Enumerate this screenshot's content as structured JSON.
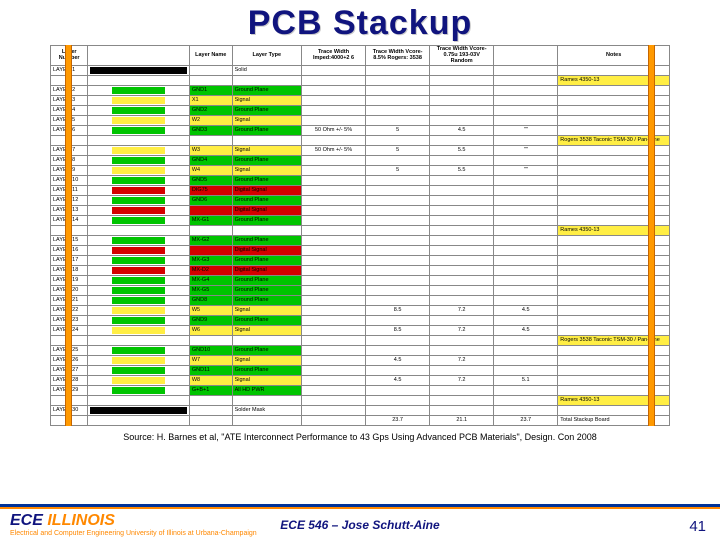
{
  "title": "PCB Stackup",
  "headers": {
    "layernum": "Layer Number",
    "layername": "Layer Name",
    "layertype": "Layer Type",
    "tw1": "Trace Width Imped:4000+2 6",
    "tw2": "Trace Width Vcore-8.5% Rogers: 3538",
    "tw3": "Trace Width Vcore-0.75u 193-03V Random",
    "notes": "Notes"
  },
  "rows": [
    {
      "ln": "LAYER 1",
      "bar": "full",
      "nm": "",
      "typ": "Solid",
      "cls": "",
      "n": ""
    },
    {
      "ln": "",
      "bar": "",
      "nm": "",
      "typ": "",
      "cls": "yel",
      "n": "Rames 4350-13"
    },
    {
      "ln": "LAYER 2",
      "bar": "gnd",
      "nm": "GND1",
      "typ": "Ground Plane",
      "cls": "",
      "n": ""
    },
    {
      "ln": "LAYER 3",
      "bar": "sig",
      "nm": "X1",
      "typ": "Signal",
      "cls": "",
      "n": ""
    },
    {
      "ln": "LAYER 4",
      "bar": "gnd",
      "nm": "GND2",
      "typ": "Ground Plane",
      "cls": "",
      "n": ""
    },
    {
      "ln": "LAYER 5",
      "bar": "sig",
      "nm": "W2",
      "typ": "Signal",
      "cls": "",
      "n": ""
    },
    {
      "ln": "LAYER 6",
      "bar": "gnd",
      "nm": "GND3",
      "typ": "Ground Plane",
      "cls": "",
      "t1": "50 Ohm +/- 5%",
      "t2": "5",
      "t3": "4.5",
      "tn": "\"\"",
      "n": ""
    },
    {
      "ln": "",
      "bar": "",
      "nm": "",
      "typ": "",
      "cls": "yel",
      "n": "Rogers 3538 Taconic TSM-30 / Pan-Fine"
    },
    {
      "ln": "LAYER 7",
      "bar": "sig",
      "nm": "W3",
      "typ": "Signal",
      "cls": "",
      "t1": "50 Ohm +/- 5%",
      "t2": "5",
      "t3": "5.5",
      "tn": "\"\"",
      "n": ""
    },
    {
      "ln": "LAYER 8",
      "bar": "gnd",
      "nm": "GND4",
      "typ": "Ground Plane",
      "cls": "",
      "n": ""
    },
    {
      "ln": "LAYER 9",
      "bar": "sig",
      "nm": "W4",
      "typ": "Signal",
      "cls": "",
      "t1": "",
      "t2": "5",
      "t3": "5.5",
      "tn": "\"\"",
      "n": ""
    },
    {
      "ln": "LAYER 10",
      "bar": "gnd",
      "nm": "GND5",
      "typ": "Ground Plane",
      "cls": "",
      "n": ""
    },
    {
      "ln": "LAYER 11",
      "bar": "dig",
      "nm": "DIG75",
      "typ": "Digital Signal",
      "cls": "",
      "n": ""
    },
    {
      "ln": "LAYER 12",
      "bar": "gnd",
      "nm": "GND6",
      "typ": "Ground Plane",
      "cls": "",
      "n": ""
    },
    {
      "ln": "LAYER 13",
      "bar": "dig",
      "nm": "",
      "typ": "Digital Signal",
      "cls": "",
      "n": ""
    },
    {
      "ln": "LAYER 14",
      "bar": "gnd",
      "nm": "MX-G1",
      "typ": "Ground Plane",
      "cls": "",
      "n": ""
    },
    {
      "ln": "",
      "bar": "",
      "nm": "",
      "typ": "",
      "cls": "yel",
      "n": "Rames 4350-13"
    },
    {
      "ln": "LAYER 15",
      "bar": "gnd",
      "nm": "MX-G2",
      "typ": "Ground Plane",
      "cls": "",
      "n": ""
    },
    {
      "ln": "LAYER 16",
      "bar": "dig",
      "nm": "",
      "typ": "Digital Signal",
      "cls": "",
      "n": ""
    },
    {
      "ln": "LAYER 17",
      "bar": "gnd",
      "nm": "MX-G3",
      "typ": "Ground Plane",
      "cls": "",
      "n": ""
    },
    {
      "ln": "LAYER 18",
      "bar": "dig",
      "nm": "MX-D2",
      "typ": "Digital Signal",
      "cls": "",
      "n": ""
    },
    {
      "ln": "LAYER 19",
      "bar": "gnd",
      "nm": "MX-G4",
      "typ": "Ground Plane",
      "cls": "",
      "n": ""
    },
    {
      "ln": "LAYER 20",
      "bar": "gnd",
      "nm": "MX-G5",
      "typ": "Ground Plane",
      "cls": "",
      "n": ""
    },
    {
      "ln": "LAYER 21",
      "bar": "gnd",
      "nm": "GND8",
      "typ": "Ground Plane",
      "cls": "",
      "n": ""
    },
    {
      "ln": "LAYER 22",
      "bar": "sig",
      "nm": "W5",
      "typ": "Signal",
      "cls": "",
      "t1": "",
      "t2": "8.5",
      "t3": "7.2",
      "tn": "4.5",
      "n": ""
    },
    {
      "ln": "LAYER 23",
      "bar": "gnd",
      "nm": "GND9",
      "typ": "Ground Plane",
      "cls": "",
      "n": ""
    },
    {
      "ln": "LAYER 24",
      "bar": "sig",
      "nm": "W6",
      "typ": "Signal",
      "cls": "",
      "t1": "",
      "t2": "8.5",
      "t3": "7.2",
      "tn": "4.5",
      "n": ""
    },
    {
      "ln": "",
      "bar": "",
      "nm": "",
      "typ": "",
      "cls": "yel",
      "n": "Rogers 3538 Taconic TSM-30 / Pan-Fine"
    },
    {
      "ln": "LAYER 25",
      "bar": "gnd",
      "nm": "GND10",
      "typ": "Ground Plane",
      "cls": "",
      "n": ""
    },
    {
      "ln": "LAYER 26",
      "bar": "sig",
      "nm": "W7",
      "typ": "Signal",
      "cls": "",
      "t1": "",
      "t2": "4.5",
      "t3": "7.2",
      "tn": "",
      "n": ""
    },
    {
      "ln": "LAYER 27",
      "bar": "gnd",
      "nm": "GND11",
      "typ": "Ground Plane",
      "cls": "",
      "n": ""
    },
    {
      "ln": "LAYER 28",
      "bar": "sig",
      "nm": "W8",
      "typ": "Signal",
      "cls": "",
      "t1": "",
      "t2": "4.5",
      "t3": "7.2",
      "tn": "5.1",
      "n": ""
    },
    {
      "ln": "LAYER 29",
      "bar": "gnd",
      "nm": "G+B+1",
      "typ": "All HD PWR",
      "cls": "",
      "n": ""
    },
    {
      "ln": "",
      "bar": "",
      "nm": "",
      "typ": "",
      "cls": "yel",
      "n": "Rames 4350-13"
    },
    {
      "ln": "LAYER 30",
      "bar": "full",
      "nm": "",
      "typ": "Solder Mask",
      "cls": "",
      "n": ""
    },
    {
      "ln": "",
      "bar": "",
      "nm": "",
      "typ": "",
      "cls": "",
      "t1": "",
      "t2": "23.7",
      "t3": "21.1",
      "tn": "23.7",
      "n": "Total Stackup Board"
    }
  ],
  "source": "Source: H. Barnes et al, \"ATE Interconnect Performance to 43 Gps Using Advanced PCB Materials\", Design. Con 2008",
  "footer": {
    "logo1": "ECE ",
    "logo2": "ILLINOIS",
    "sub": "Electrical and Computer Engineering   University of Illinois at Urbana-Champaign",
    "center": "ECE 546 – Jose Schutt-Aine",
    "page": "41"
  }
}
